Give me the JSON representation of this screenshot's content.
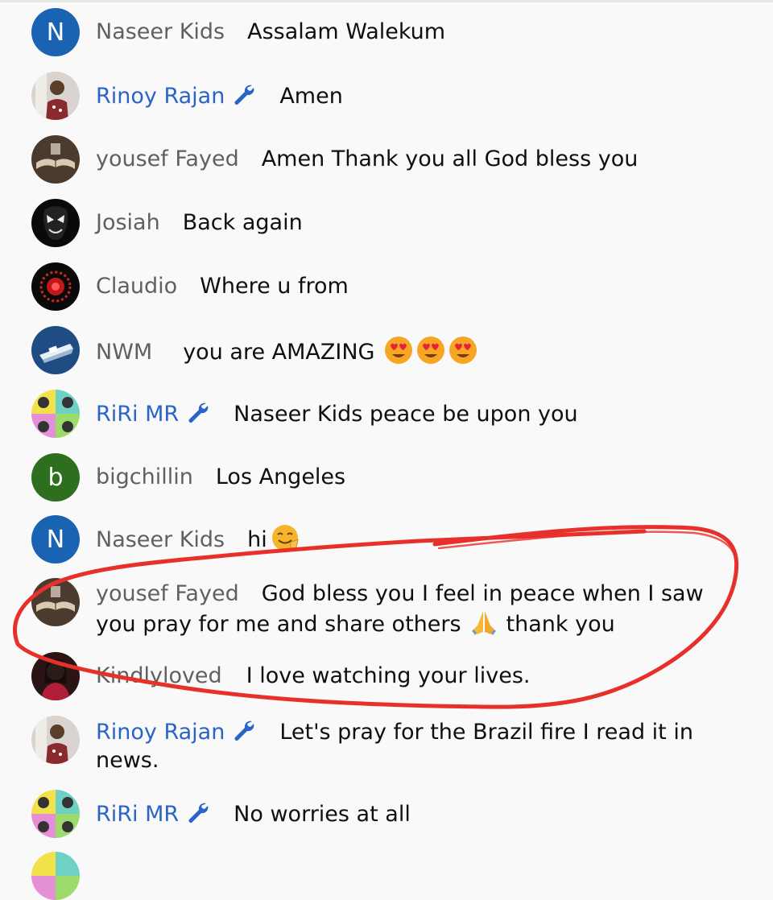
{
  "messages": [
    {
      "author": "Naseer Kids",
      "text": "Assalam Walekum",
      "moderator": false,
      "avatar": {
        "type": "letter",
        "letter": "N",
        "color": "#1a62b2"
      }
    },
    {
      "author": "Rinoy Rajan",
      "text": "Amen",
      "moderator": true,
      "avatar": {
        "type": "photo",
        "icon": "person-mirror-selfie-icon"
      }
    },
    {
      "author": "yousef Fayed",
      "text": "Amen Thank you all God bless you",
      "moderator": false,
      "avatar": {
        "type": "photo",
        "icon": "open-book-icon"
      }
    },
    {
      "author": "Josiah",
      "text": "Back again",
      "moderator": false,
      "avatar": {
        "type": "photo",
        "icon": "venom-face-icon"
      }
    },
    {
      "author": "Claudio",
      "text": "Where u from",
      "moderator": false,
      "avatar": {
        "type": "photo",
        "icon": "red-rosette-icon"
      }
    },
    {
      "author": "NWM",
      "text": "you are AMAZING",
      "moderator": false,
      "emojis": [
        "heart-eyes-emoji",
        "heart-eyes-emoji",
        "heart-eyes-emoji"
      ],
      "avatar": {
        "type": "photo",
        "icon": "ship-logo-icon"
      }
    },
    {
      "author": "RiRi MR",
      "text": "Naseer Kids peace be upon you",
      "moderator": true,
      "avatar": {
        "type": "photo",
        "icon": "pop-art-portrait-icon"
      }
    },
    {
      "author": "bigchillin",
      "text": "Los Angeles",
      "moderator": false,
      "avatar": {
        "type": "letter",
        "letter": "b",
        "color": "#2e6e1f"
      }
    },
    {
      "author": "Naseer Kids",
      "text": "hi",
      "moderator": false,
      "emojis": [
        "smile-hand-emoji"
      ],
      "avatar": {
        "type": "letter",
        "letter": "N",
        "color": "#1a62b2"
      }
    },
    {
      "author": "yousef Fayed",
      "text": "God bless you I feel in peace when I saw you pray for me and share others",
      "text_after": "thank you",
      "moderator": false,
      "emojis": [
        "praying-hands-emoji"
      ],
      "avatar": {
        "type": "photo",
        "icon": "open-book-icon"
      }
    },
    {
      "author": "Kindlyloved",
      "text": "I love watching your lives.",
      "moderator": false,
      "avatar": {
        "type": "photo",
        "icon": "woman-portrait-icon"
      }
    },
    {
      "author": "Rinoy Rajan",
      "text": "Let's pray for the Brazil fire I read it in news.",
      "moderator": true,
      "avatar": {
        "type": "photo",
        "icon": "person-mirror-selfie-icon"
      }
    },
    {
      "author": "RiRi MR",
      "text": "No worries at all",
      "moderator": true,
      "avatar": {
        "type": "photo",
        "icon": "pop-art-portrait-icon"
      }
    }
  ],
  "colors": {
    "moderator_name": "#2a64c6",
    "author_name": "#606060",
    "annotation": "#e8302a",
    "background": "#f9f9f9"
  },
  "annotation": {
    "type": "red-hand-drawn-circle"
  }
}
